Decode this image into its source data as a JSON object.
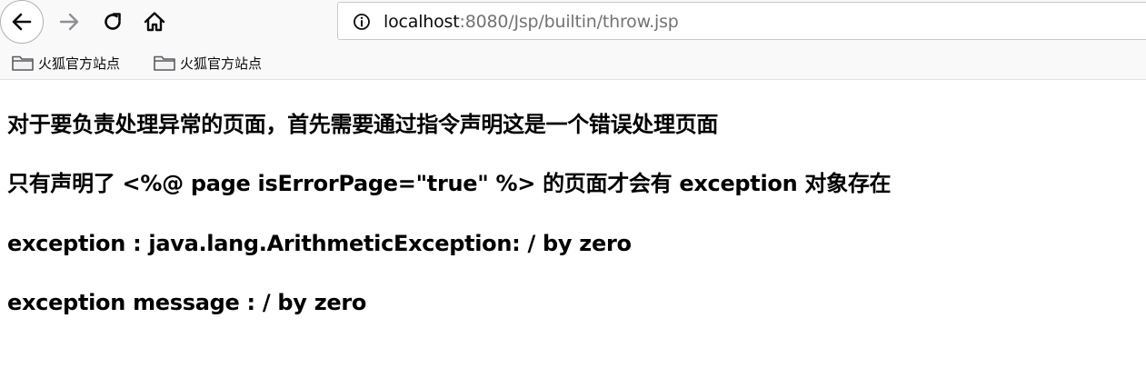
{
  "toolbar": {
    "url_host": "localhost",
    "url_rest": ":8080/Jsp/builtin/throw.jsp",
    "icons": {
      "back": "arrow-left-icon",
      "forward": "arrow-right-icon",
      "reload": "reload-icon",
      "home": "home-icon",
      "info": "info-icon"
    }
  },
  "bookmarks": {
    "items": [
      {
        "label": "火狐官方站点",
        "icon": "folder-icon"
      },
      {
        "label": "火狐官方站点",
        "icon": "folder-icon"
      }
    ]
  },
  "content": {
    "lines": [
      "对于要负责处理异常的页面，首先需要通过指令声明这是一个错误处理页面",
      "只有声明了 <%@ page isErrorPage=\"true\" %> 的页面才会有 exception 对象存在",
      "exception : java.lang.ArithmeticException: / by zero",
      "exception message : / by zero"
    ]
  },
  "colors": {
    "toolbar_bg": "#f9f9fa",
    "url_host": "#0c0c0d",
    "url_path": "#737373",
    "text": "#000000"
  }
}
